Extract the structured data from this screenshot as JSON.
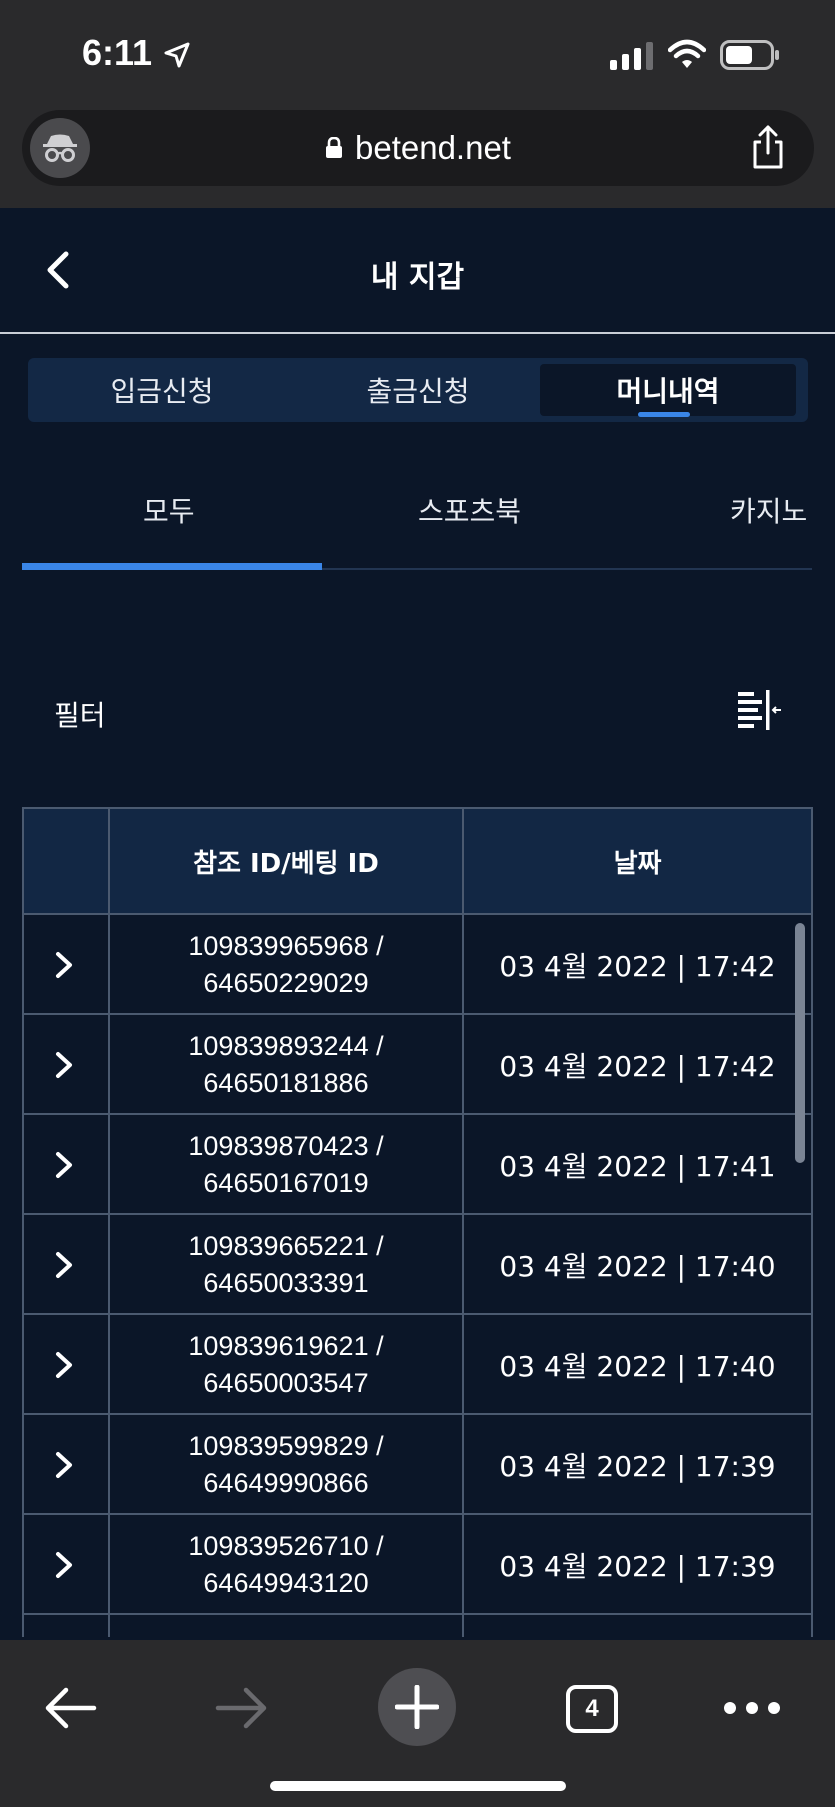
{
  "status_bar": {
    "time": "6:11"
  },
  "browser": {
    "url": "betend.net",
    "tab_count": "4"
  },
  "header": {
    "title": "내 지갑"
  },
  "segment_tabs": [
    {
      "label": "입금신청",
      "active": false
    },
    {
      "label": "출금신청",
      "active": false
    },
    {
      "label": "머니내역",
      "active": true
    }
  ],
  "category_tabs": [
    {
      "label": "모두",
      "active": true
    },
    {
      "label": "스포츠북",
      "active": false
    },
    {
      "label": "카지노",
      "active": false
    }
  ],
  "filter": {
    "label": "필터"
  },
  "table": {
    "columns": [
      "",
      "참조 ID/베팅 ID",
      "날짜"
    ],
    "rows": [
      {
        "ref_id": "109839965968 /",
        "bet_id": "64650229029",
        "date": "03 4월 2022 | 17:42"
      },
      {
        "ref_id": "109839893244 /",
        "bet_id": "64650181886",
        "date": "03 4월 2022 | 17:42"
      },
      {
        "ref_id": "109839870423 /",
        "bet_id": "64650167019",
        "date": "03 4월 2022 | 17:41"
      },
      {
        "ref_id": "109839665221 /",
        "bet_id": "64650033391",
        "date": "03 4월 2022 | 17:40"
      },
      {
        "ref_id": "109839619621 /",
        "bet_id": "64650003547",
        "date": "03 4월 2022 | 17:40"
      },
      {
        "ref_id": "109839599829 /",
        "bet_id": "64649990866",
        "date": "03 4월 2022 | 17:39"
      },
      {
        "ref_id": "109839526710 /",
        "bet_id": "64649943120",
        "date": "03 4월 2022 | 17:39"
      }
    ]
  },
  "colors": {
    "accent": "#3a86e8",
    "background": "#0b1628",
    "header_bg": "#122744"
  }
}
